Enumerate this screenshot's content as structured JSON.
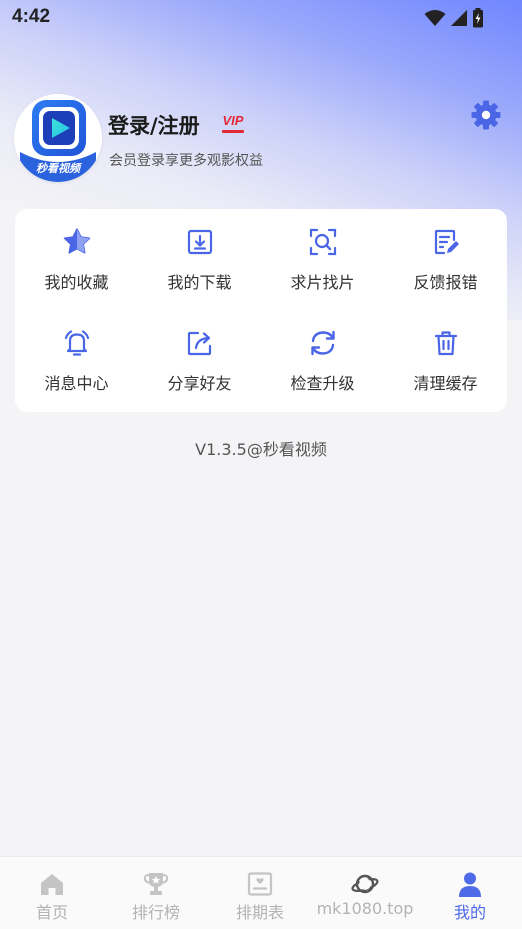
{
  "status_bar": {
    "time": "4:42"
  },
  "profile": {
    "avatar_caption": "秒看视频",
    "login_title": "登录/注册",
    "vip_badge": "VIP",
    "subtitle": "会员登录享更多观影权益"
  },
  "grid": {
    "items": [
      {
        "label": "我的收藏",
        "icon": "star-icon"
      },
      {
        "label": "我的下载",
        "icon": "download-icon"
      },
      {
        "label": "求片找片",
        "icon": "search-film-icon"
      },
      {
        "label": "反馈报错",
        "icon": "feedback-edit-icon"
      },
      {
        "label": "消息中心",
        "icon": "bell-icon"
      },
      {
        "label": "分享好友",
        "icon": "share-icon"
      },
      {
        "label": "检查升级",
        "icon": "refresh-icon"
      },
      {
        "label": "清理缓存",
        "icon": "trash-icon"
      }
    ]
  },
  "version_text": "V1.3.5@秒看视频",
  "bottom_nav": {
    "items": [
      {
        "label": "首页",
        "icon": "home-icon",
        "active": false
      },
      {
        "label": "排行榜",
        "icon": "trophy-icon",
        "active": false
      },
      {
        "label": "排期表",
        "icon": "schedule-icon",
        "active": false
      },
      {
        "label": "mk1080.top",
        "icon": "planet-icon",
        "active": false
      },
      {
        "label": "我的",
        "icon": "person-icon",
        "active": true
      }
    ]
  },
  "colors": {
    "accent": "#4f6ae8",
    "icon_blue": "#4a66e6",
    "vip_red": "#e22a36",
    "inactive_gray": "#b3b3b3"
  }
}
